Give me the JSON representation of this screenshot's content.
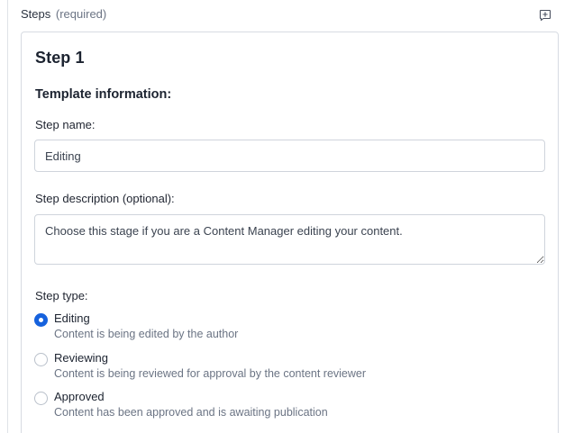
{
  "field": {
    "label": "Steps",
    "required_note": "(required)",
    "comment_icon": "add-comment-icon"
  },
  "step": {
    "title": "Step 1",
    "section_title": "Template information:",
    "name_label": "Step name:",
    "name_value": "Editing",
    "description_label": "Step description (optional):",
    "description_value": "Choose this stage if you are a Content Manager editing your content.",
    "type_label": "Step type:",
    "types": [
      {
        "label": "Editing",
        "description": "Content is being edited by the author",
        "checked": true
      },
      {
        "label": "Reviewing",
        "description": "Content is being reviewed for approval by the content reviewer",
        "checked": false
      },
      {
        "label": "Approved",
        "description": "Content has been approved and is awaiting publication",
        "checked": false
      }
    ]
  },
  "colors": {
    "accent": "#1662dd",
    "border": "#d7dbe2",
    "muted_text": "#6b7484"
  }
}
